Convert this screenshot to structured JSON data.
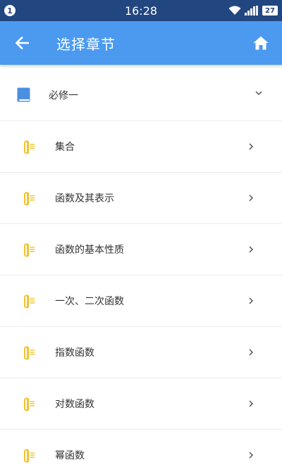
{
  "status_bar": {
    "notification_count": "1",
    "time": "16:28",
    "battery": "27",
    "icons": [
      "wifi-icon",
      "signal-icon",
      "battery-icon"
    ]
  },
  "header": {
    "title": "选择章节",
    "back_icon": "arrow-left-icon",
    "home_icon": "home-icon"
  },
  "volume": {
    "label": "必修一",
    "icon": "book-icon",
    "expanded": true
  },
  "chapters": [
    {
      "label": "集合"
    },
    {
      "label": "函数及其表示"
    },
    {
      "label": "函数的基本性质"
    },
    {
      "label": "一次、二次函数"
    },
    {
      "label": "指数函数"
    },
    {
      "label": "对数函数"
    },
    {
      "label": "幂函数"
    }
  ],
  "colors": {
    "status_bar": "#22467f",
    "app_bar": "#4b9af0",
    "book_icon": "#4a8fe0",
    "chapter_icon": "#f2c230",
    "divider": "#ececec"
  }
}
